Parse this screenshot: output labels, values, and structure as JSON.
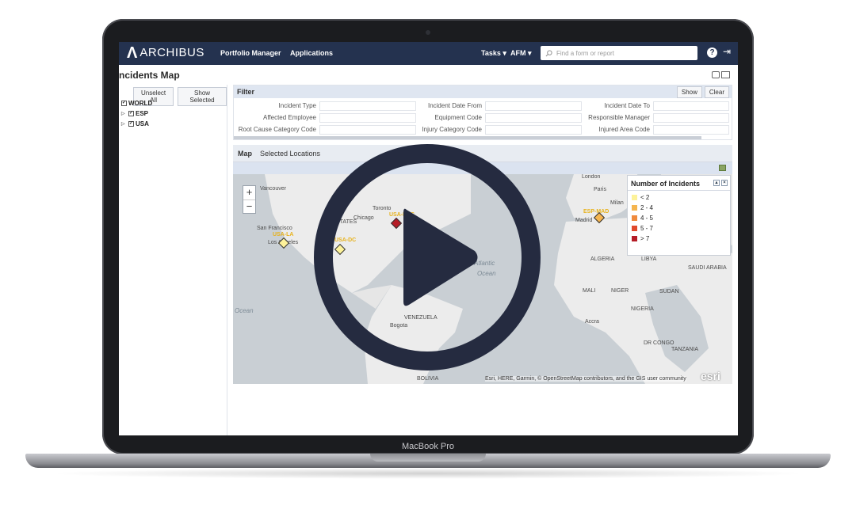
{
  "device": {
    "chin_label": "MacBook Pro"
  },
  "nav": {
    "logo_text": "ARCHIBUS",
    "links": [
      "Portfolio Manager",
      "Applications"
    ],
    "tasks": "Tasks ▾",
    "afm": "AFM ▾",
    "search_placeholder": "Find a form or report"
  },
  "page": {
    "title": "ncidents Map"
  },
  "tree": {
    "buttons": [
      "Unselect All",
      "Show Selected"
    ],
    "items": [
      "WORLD",
      "ESP",
      "USA"
    ]
  },
  "filter": {
    "title": "Filter",
    "buttons": [
      "Show",
      "Clear"
    ],
    "fields": [
      "Incident Type",
      "Incident Date From",
      "Incident Date To",
      "Affected Employee",
      "Equipment Code",
      "Responsible Manager",
      "Root Cause Category Code",
      "Injury Category Code",
      "Injured Area Code"
    ]
  },
  "map_tabs": [
    "Map",
    "Selected Locations"
  ],
  "map": {
    "labels": [
      "London",
      "Paris",
      "Milan",
      "Madrid",
      "Vancouver",
      "Toronto",
      "Chicago",
      "San Francisco",
      "Los Angeles",
      "Bogota",
      "VENEZUELA",
      "ALGERIA",
      "LIBYA",
      "SAUDI ARABIA",
      "MALI",
      "NIGER",
      "SUDAN",
      "NIGERIA",
      "Accra",
      "DR CONGO",
      "TANZANIA",
      "BOLIVIA",
      "STATES"
    ],
    "ocean_labels": [
      "Atlantic",
      "Ocean",
      "Ocean"
    ],
    "marker_labels": [
      "USA-NYC",
      "USA-LA",
      "USA-DC",
      "ESP-MAD"
    ],
    "attribution": "Esri, HERE, Garmin, © OpenStreetMap contributors, and the GIS user community",
    "esri": "esri",
    "zoom_in": "+",
    "zoom_out": "−"
  },
  "legend": {
    "title": "Number of Incidents",
    "rows": [
      {
        "label": "< 2",
        "color": "#fdf29a"
      },
      {
        "label": "2 - 4",
        "color": "#f5b54f"
      },
      {
        "label": "4 - 5",
        "color": "#ef8a3d"
      },
      {
        "label": "5 - 7",
        "color": "#e0492c"
      },
      {
        "label": "> 7",
        "color": "#b51c26"
      }
    ]
  },
  "colors": {
    "nav": "#24324f",
    "play": "#252b40"
  }
}
